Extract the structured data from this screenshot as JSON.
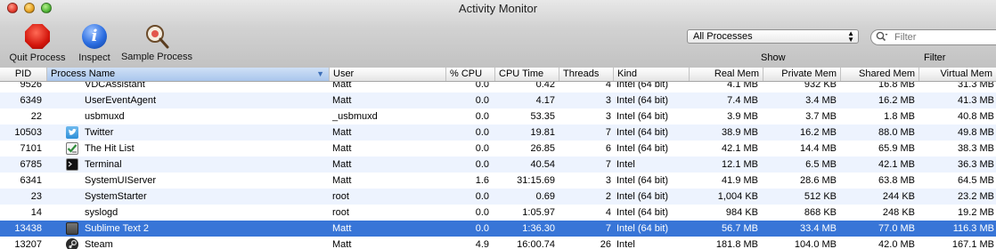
{
  "window": {
    "title": "Activity Monitor"
  },
  "toolbar": {
    "quit_label": "Quit Process",
    "inspect_label": "Inspect",
    "sample_label": "Sample Process",
    "process_filter": "All Processes",
    "show_label": "Show",
    "search_placeholder": "Filter",
    "filter_label": "Filter"
  },
  "columns": {
    "pid": "PID",
    "name": "Process Name",
    "user": "User",
    "cpu": "% CPU",
    "cpu_time": "CPU Time",
    "threads": "Threads",
    "kind": "Kind",
    "real_mem": "Real Mem",
    "private_mem": "Private Mem",
    "shared_mem": "Shared Mem",
    "virtual_mem": "Virtual Mem"
  },
  "rows": [
    {
      "pid": "9526",
      "name": "VDCAssistant",
      "user": "Matt",
      "cpu": "0.0",
      "cpu_time": "0.42",
      "threads": "4",
      "kind": "Intel (64 bit)",
      "real_mem": "4.1 MB",
      "private_mem": "932 KB",
      "shared_mem": "16.8 MB",
      "virtual_mem": "31.3 MB",
      "icon": "none"
    },
    {
      "pid": "6349",
      "name": "UserEventAgent",
      "user": "Matt",
      "cpu": "0.0",
      "cpu_time": "4.17",
      "threads": "3",
      "kind": "Intel (64 bit)",
      "real_mem": "7.4 MB",
      "private_mem": "3.4 MB",
      "shared_mem": "16.2 MB",
      "virtual_mem": "41.3 MB",
      "icon": "none"
    },
    {
      "pid": "22",
      "name": "usbmuxd",
      "user": "_usbmuxd",
      "cpu": "0.0",
      "cpu_time": "53.35",
      "threads": "3",
      "kind": "Intel (64 bit)",
      "real_mem": "3.9 MB",
      "private_mem": "3.7 MB",
      "shared_mem": "1.8 MB",
      "virtual_mem": "40.8 MB",
      "icon": "none"
    },
    {
      "pid": "10503",
      "name": "Twitter",
      "user": "Matt",
      "cpu": "0.0",
      "cpu_time": "19.81",
      "threads": "7",
      "kind": "Intel (64 bit)",
      "real_mem": "38.9 MB",
      "private_mem": "16.2 MB",
      "shared_mem": "88.0 MB",
      "virtual_mem": "49.8 MB",
      "icon": "twitter-icon"
    },
    {
      "pid": "7101",
      "name": "The Hit List",
      "user": "Matt",
      "cpu": "0.0",
      "cpu_time": "26.85",
      "threads": "6",
      "kind": "Intel (64 bit)",
      "real_mem": "42.1 MB",
      "private_mem": "14.4 MB",
      "shared_mem": "65.9 MB",
      "virtual_mem": "38.3 MB",
      "icon": "hit-list-icon"
    },
    {
      "pid": "6785",
      "name": "Terminal",
      "user": "Matt",
      "cpu": "0.0",
      "cpu_time": "40.54",
      "threads": "7",
      "kind": "Intel",
      "real_mem": "12.1 MB",
      "private_mem": "6.5 MB",
      "shared_mem": "42.1 MB",
      "virtual_mem": "36.3 MB",
      "icon": "terminal-icon"
    },
    {
      "pid": "6341",
      "name": "SystemUIServer",
      "user": "Matt",
      "cpu": "1.6",
      "cpu_time": "31:15.69",
      "threads": "3",
      "kind": "Intel (64 bit)",
      "real_mem": "41.9 MB",
      "private_mem": "28.6 MB",
      "shared_mem": "63.8 MB",
      "virtual_mem": "64.5 MB",
      "icon": "none"
    },
    {
      "pid": "23",
      "name": "SystemStarter",
      "user": "root",
      "cpu": "0.0",
      "cpu_time": "0.69",
      "threads": "2",
      "kind": "Intel (64 bit)",
      "real_mem": "1,004 KB",
      "private_mem": "512 KB",
      "shared_mem": "244 KB",
      "virtual_mem": "23.2 MB",
      "icon": "none"
    },
    {
      "pid": "14",
      "name": "syslogd",
      "user": "root",
      "cpu": "0.0",
      "cpu_time": "1:05.97",
      "threads": "4",
      "kind": "Intel (64 bit)",
      "real_mem": "984 KB",
      "private_mem": "868 KB",
      "shared_mem": "248 KB",
      "virtual_mem": "19.2 MB",
      "icon": "none"
    },
    {
      "pid": "13438",
      "name": "Sublime Text 2",
      "user": "Matt",
      "cpu": "0.0",
      "cpu_time": "1:36.30",
      "threads": "7",
      "kind": "Intel (64 bit)",
      "real_mem": "56.7 MB",
      "private_mem": "33.4 MB",
      "shared_mem": "77.0 MB",
      "virtual_mem": "116.3 MB",
      "icon": "sublime-text-icon",
      "selected": true
    },
    {
      "pid": "13207",
      "name": "Steam",
      "user": "Matt",
      "cpu": "4.9",
      "cpu_time": "16:00.74",
      "threads": "26",
      "kind": "Intel",
      "real_mem": "181.8 MB",
      "private_mem": "104.0 MB",
      "shared_mem": "42.0 MB",
      "virtual_mem": "167.1 MB",
      "icon": "steam-icon"
    }
  ],
  "colors": {
    "selection": "#3875d7",
    "alt_row": "#edf3fe",
    "twitter": "#2f8fd8",
    "hit_list": "#2e8b3a"
  }
}
